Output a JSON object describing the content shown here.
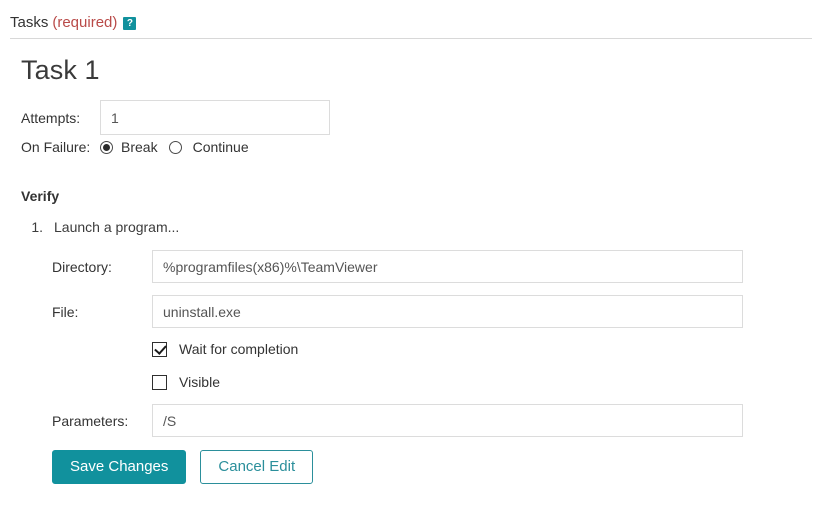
{
  "section": {
    "title": "Tasks",
    "required_label": "(required)",
    "help_icon": "help-question-icon",
    "help_glyph": "?"
  },
  "task": {
    "title": "Task 1",
    "attempts": {
      "label": "Attempts:",
      "value": "1"
    },
    "on_failure": {
      "label": "On Failure:",
      "options": [
        {
          "label": "Break",
          "selected": true
        },
        {
          "label": "Continue",
          "selected": false
        }
      ]
    }
  },
  "verify": {
    "heading": "Verify",
    "step": {
      "number": "1.",
      "text": "Launch a program..."
    },
    "fields": [
      {
        "label": "Directory:",
        "value": "%programfiles(x86)%\\TeamViewer"
      },
      {
        "label": "File:",
        "value": "uninstall.exe"
      },
      {
        "label": "Parameters:",
        "value": "/S"
      }
    ],
    "checkboxes": [
      {
        "label": "Wait for completion",
        "checked": true
      },
      {
        "label": "Visible",
        "checked": false
      }
    ]
  },
  "buttons": {
    "save": "Save Changes",
    "cancel": "Cancel Edit"
  },
  "colors": {
    "accent_teal": "#11919d",
    "required_red": "#b94a48",
    "border_gray": "#dcdcdc",
    "text_dark": "#333333"
  }
}
